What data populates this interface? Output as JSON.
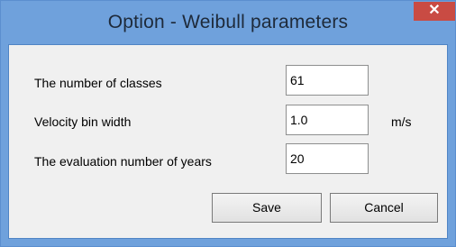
{
  "window": {
    "title": "Option - Weibull parameters",
    "close_glyph": "✕",
    "close_icon": "close-icon"
  },
  "form": {
    "classes": {
      "label": "The number of classes",
      "value": "61"
    },
    "bin_width": {
      "label": "Velocity bin width",
      "value": "1.0",
      "unit": "m/s"
    },
    "years": {
      "label": "The evaluation number of years",
      "value": "20"
    }
  },
  "buttons": {
    "save": "Save",
    "cancel": "Cancel"
  },
  "colors": {
    "title_bar": "#6fa1dc",
    "close_button": "#c94b43",
    "client_area": "#f0f0f0"
  }
}
